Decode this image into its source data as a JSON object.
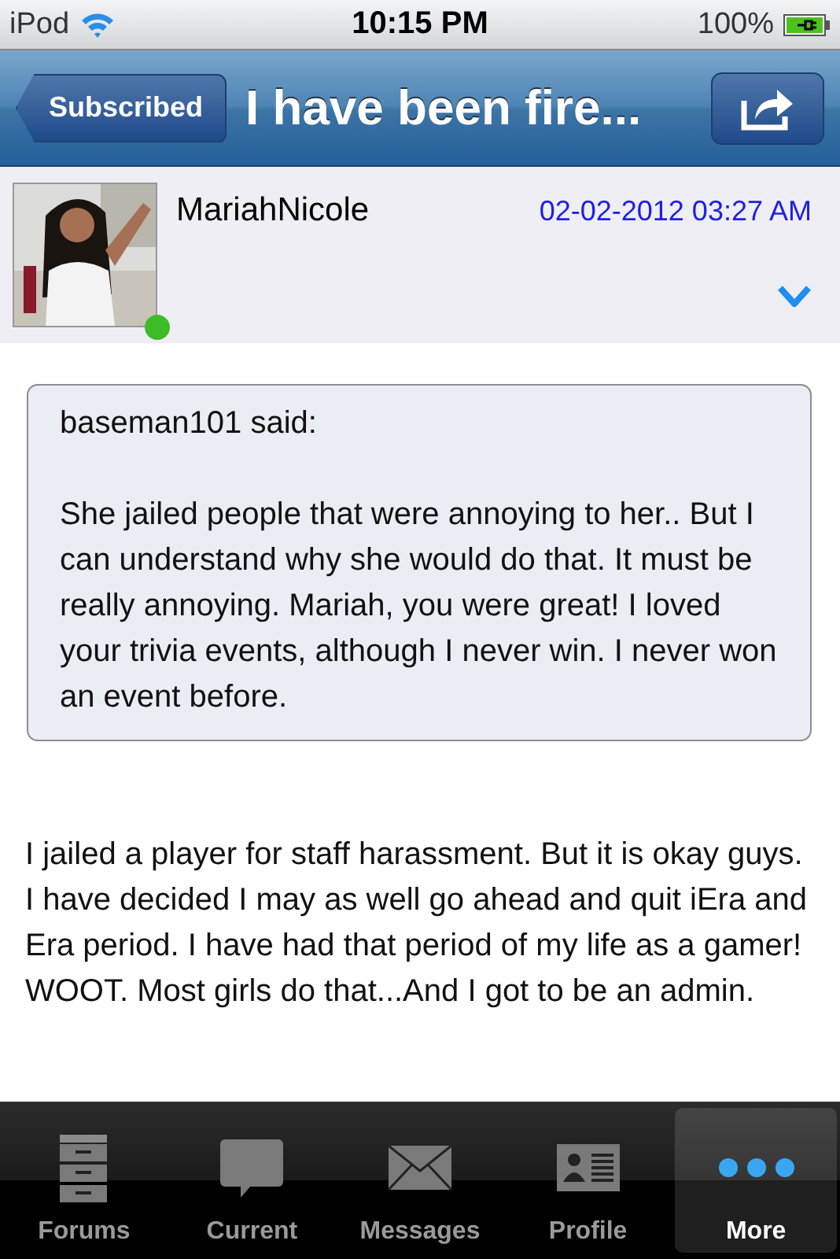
{
  "status_bar": {
    "device": "iPod",
    "time": "10:15 PM",
    "battery": "100%"
  },
  "nav_bar": {
    "back_button": "Subscribed",
    "title": "I have been fire..."
  },
  "post": {
    "author": "MariahNicole",
    "online": true,
    "date": "02-02-2012 03:27 AM",
    "quote": {
      "attribution": "baseman101 said:",
      "text": "She jailed people that were annoying to her.. But I can understand why she would do that. It must be really annoying. Mariah, you were great! I loved your trivia events, although I never win. I never won an event before."
    },
    "body": "I jailed a player for staff harassment. But it is okay guys. I have decided I may as well go ahead and quit iEra and Era period. I have had that period of my life as a gamer! WOOT. Most girls do that...And I got to be an admin."
  },
  "tab_bar": [
    {
      "kind": "cabinet",
      "label": "Forums",
      "selected": false
    },
    {
      "kind": "bubble",
      "label": "Current",
      "selected": false
    },
    {
      "kind": "envelope",
      "label": "Messages",
      "selected": false
    },
    {
      "kind": "card",
      "label": "Profile",
      "selected": false
    },
    {
      "kind": "dots",
      "label": "More",
      "selected": true
    }
  ]
}
